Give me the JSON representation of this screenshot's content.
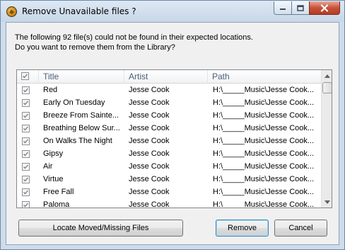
{
  "window": {
    "title": "Remove Unavailable files ?"
  },
  "message": {
    "line1": "The following 92 file(s) could not be found in their expected locations.",
    "line2": "Do you want to remove them from the Library?"
  },
  "list": {
    "columns": {
      "title": "Title",
      "artist": "Artist",
      "path": "Path"
    },
    "rows": [
      {
        "title": "Red",
        "artist": "Jesse Cook",
        "path": "H:\\_____Music\\Jesse Cook...",
        "checked": true
      },
      {
        "title": "Early On Tuesday",
        "artist": "Jesse Cook",
        "path": "H:\\_____Music\\Jesse Cook...",
        "checked": true
      },
      {
        "title": "Breeze From Sainte...",
        "artist": "Jesse Cook",
        "path": "H:\\_____Music\\Jesse Cook...",
        "checked": true
      },
      {
        "title": "Breathing Below Sur...",
        "artist": "Jesse Cook",
        "path": "H:\\_____Music\\Jesse Cook...",
        "checked": true
      },
      {
        "title": "On Walks The Night",
        "artist": "Jesse Cook",
        "path": "H:\\_____Music\\Jesse Cook...",
        "checked": true
      },
      {
        "title": "Gipsy",
        "artist": "Jesse Cook",
        "path": "H:\\_____Music\\Jesse Cook...",
        "checked": true
      },
      {
        "title": "Air",
        "artist": "Jesse Cook",
        "path": "H:\\_____Music\\Jesse Cook...",
        "checked": true
      },
      {
        "title": "Virtue",
        "artist": "Jesse Cook",
        "path": "H:\\_____Music\\Jesse Cook...",
        "checked": true
      },
      {
        "title": "Free Fall",
        "artist": "Jesse Cook",
        "path": "H:\\_____Music\\Jesse Cook...",
        "checked": true
      },
      {
        "title": "Paloma",
        "artist": "Jesse Cook",
        "path": "H:\\_____Music\\Jesse Cook...",
        "checked": true
      }
    ]
  },
  "buttons": {
    "locate": "Locate Moved/Missing Files",
    "remove": "Remove",
    "cancel": "Cancel"
  },
  "icons": {
    "app": "mediamonkey-icon",
    "minimize": "minimize-icon",
    "maximize": "maximize-icon",
    "close": "close-icon",
    "checkbox": "checkmark-icon",
    "scroll_up": "chevron-up-icon",
    "scroll_down": "chevron-down-icon"
  },
  "colors": {
    "close_button": "#c7523a",
    "header_text": "#4c607a",
    "default_button_border": "#3c7fb1"
  }
}
